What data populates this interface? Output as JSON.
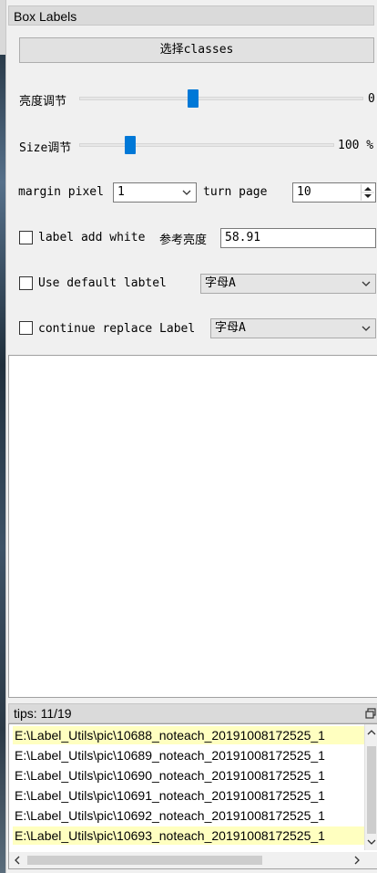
{
  "panel": {
    "title": "Box Labels",
    "classes_button": "选择classes"
  },
  "brightness": {
    "label": "亮度调节",
    "value": "0",
    "level": 0.4
  },
  "size": {
    "label": "Size调节",
    "value": "100 %",
    "level": 0.2
  },
  "margin": {
    "label": "margin pixel",
    "value": "1",
    "turn_page_label": "turn page",
    "turn_page_value": "10"
  },
  "label_white": {
    "label": "label add white",
    "ref_label": "参考亮度",
    "ref_value": "58.91",
    "checked": false
  },
  "default_label": {
    "label": "Use default labtel",
    "value": "字母A",
    "checked": false
  },
  "continue_replace": {
    "label": "continue replace Label",
    "value": "字母A",
    "checked": false
  },
  "tips": {
    "title": "tips: 11/19",
    "items": [
      "E:\\Label_Utils\\pic\\10688_noteach_20191008172525_1",
      "E:\\Label_Utils\\pic\\10689_noteach_20191008172525_1",
      "E:\\Label_Utils\\pic\\10690_noteach_20191008172525_1",
      "E:\\Label_Utils\\pic\\10691_noteach_20191008172525_1",
      "E:\\Label_Utils\\pic\\10692_noteach_20191008172525_1",
      "E:\\Label_Utils\\pic\\10693_noteach_20191008172525_1"
    ]
  },
  "colors": {
    "slider_thumb": "#0078d7",
    "highlight_row": "#ffffc0"
  }
}
